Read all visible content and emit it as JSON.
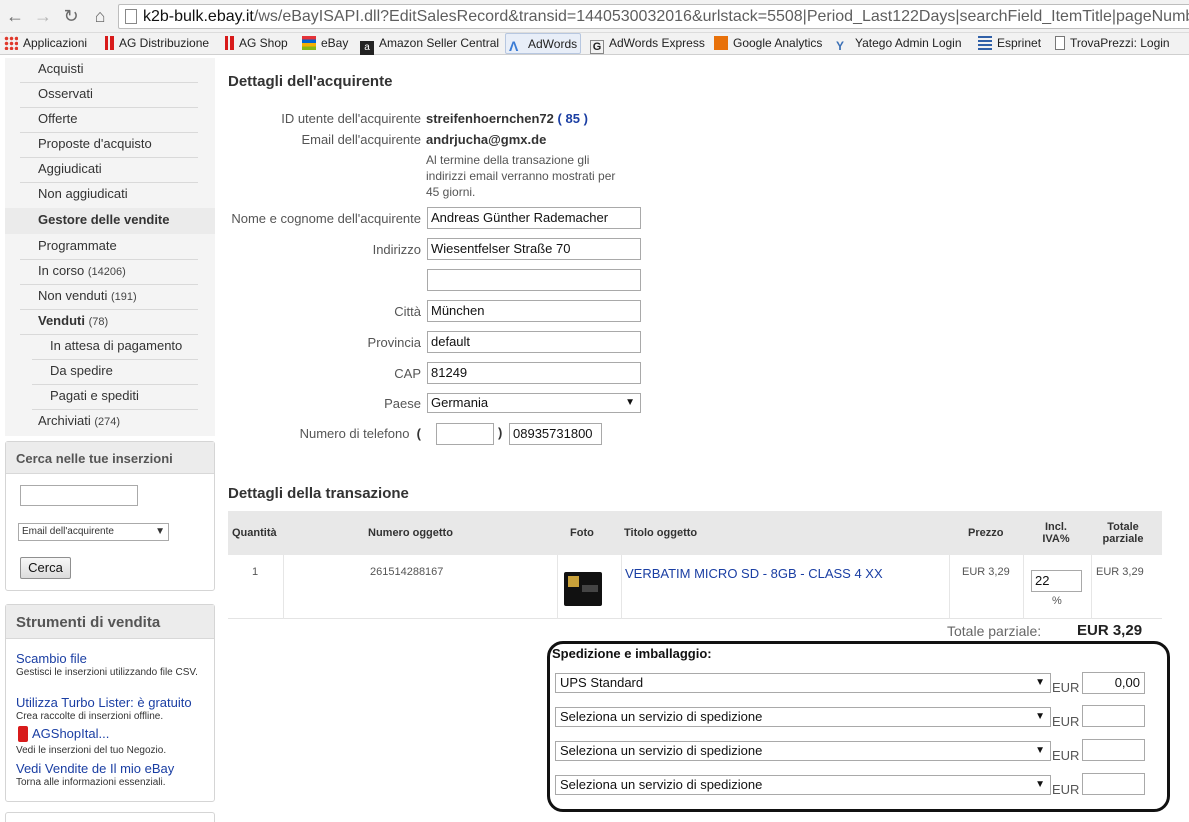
{
  "browser": {
    "url_host": "k2b-bulk.ebay.it",
    "url_path": "/ws/eBayISAPI.dll?EditSalesRecord&transid=1440530032016&urlstack=5508|Period_Last122Days|searchField_ItemTitle|pageNumber_",
    "bookmarks": [
      {
        "label": "Applicazioni",
        "icon": "apps-grid-icon",
        "color": "#e0382b"
      },
      {
        "label": "AG Distribuzione",
        "icon": "ag-logo-icon",
        "color": "#d81b1b"
      },
      {
        "label": "AG Shop",
        "icon": "ag-logo-icon",
        "color": "#d81b1b"
      },
      {
        "label": "eBay",
        "icon": "ebay-icon",
        "color": "#e53238"
      },
      {
        "label": "Amazon Seller Central",
        "icon": "amazon-icon",
        "color": "#222222"
      },
      {
        "label": "AdWords",
        "icon": "adwords-icon",
        "color": "#3a7bd5"
      },
      {
        "label": "AdWords Express",
        "icon": "google-g-icon",
        "color": "#555555"
      },
      {
        "label": "Google Analytics",
        "icon": "analytics-icon",
        "color": "#e8710a"
      },
      {
        "label": "Yatego Admin Login",
        "icon": "yatego-icon",
        "color": "#3a6fb5"
      },
      {
        "label": "Esprinet",
        "icon": "esprinet-icon",
        "color": "#3060a8"
      },
      {
        "label": "TrovaPrezzi: Login",
        "icon": "page-icon",
        "color": "#777777"
      }
    ]
  },
  "leftnav": {
    "items": [
      {
        "label": "Acquisti",
        "count": ""
      },
      {
        "label": "Osservati",
        "count": ""
      },
      {
        "label": "Offerte",
        "count": ""
      },
      {
        "label": "Proposte d'acquisto",
        "count": ""
      },
      {
        "label": "Aggiudicati",
        "count": ""
      },
      {
        "label": "Non aggiudicati",
        "count": ""
      }
    ],
    "section_title": "Gestore delle vendite",
    "sales_items": [
      {
        "label": "Programmate",
        "count": ""
      },
      {
        "label": "In corso",
        "count": "(14206)"
      },
      {
        "label": "Non venduti",
        "count": "(191)"
      },
      {
        "label": "Venduti",
        "count": "(78)"
      },
      {
        "label": "In attesa di pagamento",
        "count": ""
      },
      {
        "label": "Da spedire",
        "count": ""
      },
      {
        "label": "Pagati e spediti",
        "count": ""
      },
      {
        "label": "Archiviati",
        "count": "(274)"
      }
    ]
  },
  "search_panel": {
    "title": "Cerca nelle tue inserzioni",
    "field_option": "Email dell'acquirente",
    "button": "Cerca"
  },
  "tools_panel": {
    "title": "Strumenti di vendita",
    "links": [
      {
        "label": "Scambio file",
        "desc": "Gestisci le inserzioni utilizzando file CSV."
      },
      {
        "label": "Utilizza Turbo Lister: è gratuito",
        "desc": "Crea raccolte di inserzioni offline."
      },
      {
        "label": "AGShopItal...",
        "desc": "Vedi le inserzioni del tuo Negozio."
      },
      {
        "label": "Vedi Vendite de Il mio eBay",
        "desc": "Torna alle informazioni essenziali."
      }
    ]
  },
  "buyer": {
    "section_title": "Dettagli dell'acquirente",
    "user_id_label": "ID utente dell'acquirente",
    "user_id": "streifenhoernchen72",
    "feedback_open": "(",
    "feedback": "85",
    "feedback_close": ")",
    "email_label": "Email dell'acquirente",
    "email": "andrjucha@gmx.de",
    "email_note": "Al termine della transazione gli indirizzi email verranno mostrati per 45 giorni.",
    "name_label": "Nome e cognome dell'acquirente",
    "name": "Andreas Günther Rademacher",
    "address_label": "Indirizzo",
    "address1": "Wiesentfelser Straße 70",
    "address2": "",
    "city_label": "Città",
    "city": "München",
    "province_label": "Provincia",
    "province": "default",
    "zip_label": "CAP",
    "zip": "81249",
    "country_label": "Paese",
    "country": "Germania",
    "phone_label": "Numero di telefono",
    "phone_prefix": "",
    "phone_number": "08935731800"
  },
  "transaction": {
    "section_title": "Dettagli della transazione",
    "columns": [
      "Quantità",
      "Numero oggetto",
      "Foto",
      "Titolo oggetto",
      "Prezzo",
      "Incl. IVA%",
      "Totale parziale"
    ],
    "row": {
      "quantity": "1",
      "item_number": "261514288167",
      "title": "VERBATIM MICRO SD - 8GB - CLASS 4 XX",
      "price": "EUR 3,29",
      "vat": "22",
      "vat_unit": "%",
      "subtotal": "EUR 3,29"
    },
    "subtotal_label": "Totale parziale:",
    "subtotal_value": "EUR 3,29"
  },
  "shipping": {
    "title": "Spedizione e imballaggio:",
    "currency": "EUR",
    "rows": [
      {
        "service": "UPS Standard",
        "amount": "0,00"
      },
      {
        "service": "Seleziona un servizio di spedizione",
        "amount": ""
      },
      {
        "service": "Seleziona un servizio di spedizione",
        "amount": ""
      },
      {
        "service": "Seleziona un servizio di spedizione",
        "amount": ""
      }
    ]
  }
}
